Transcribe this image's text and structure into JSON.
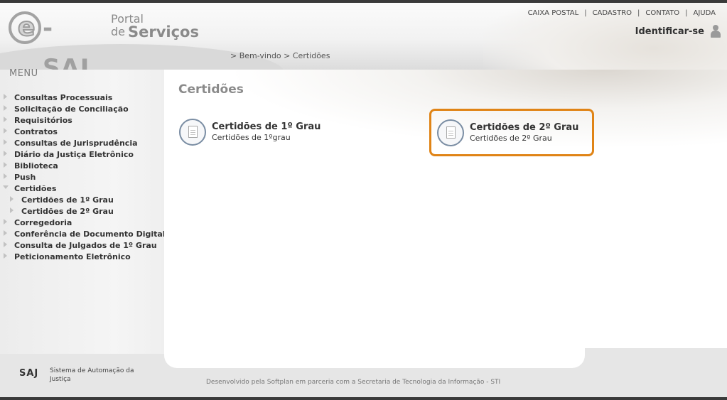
{
  "header": {
    "logo": {
      "e": "e",
      "saj": "-SAJ",
      "portal": "Portal",
      "de": "de",
      "servicos": "Serviços"
    },
    "top_links": [
      "CAIXA POSTAL",
      "CADASTRO",
      "CONTATO",
      "AJUDA"
    ],
    "identify_label": "Identificar-se",
    "breadcrumb": "> Bem-vindo > Certidões"
  },
  "sidebar": {
    "title": "MENU",
    "items": [
      {
        "label": "Consultas Processuais"
      },
      {
        "label": "Solicitação de Conciliação"
      },
      {
        "label": "Requisitórios"
      },
      {
        "label": "Contratos"
      },
      {
        "label": "Consultas de Jurisprudência"
      },
      {
        "label": "Diário da Justiça Eletrônico"
      },
      {
        "label": "Biblioteca"
      },
      {
        "label": "Push"
      },
      {
        "label": "Certidões"
      },
      {
        "label": "Certidões de 1º Grau"
      },
      {
        "label": "Certidões de 2º Grau"
      },
      {
        "label": "Corregedoria"
      },
      {
        "label": "Conferência de Documento Digital"
      },
      {
        "label": "Consulta de Julgados de 1º Grau"
      },
      {
        "label": "Peticionamento Eletrônico"
      }
    ]
  },
  "main": {
    "heading": "Certidões",
    "cards": [
      {
        "title": "Certidões de 1º Grau",
        "subtitle": "Certidões de 1ºgrau"
      },
      {
        "title": "Certidões de 2º Grau",
        "subtitle": "Certidões de 2º Grau"
      }
    ]
  },
  "footer": {
    "logo": "SAJ",
    "system_name": "Sistema de Automação da Justiça",
    "developed_by": "Desenvolvido pela Softplan em parceria com a Secretaria de Tecnologia da Informação - STI"
  },
  "colors": {
    "highlight_border": "#e08416",
    "icon_ring": "#7a8da3",
    "header_dark_line": "#3a3a3a"
  },
  "icons": [
    "user-icon",
    "document-icon",
    "menu-arrow-icon"
  ]
}
